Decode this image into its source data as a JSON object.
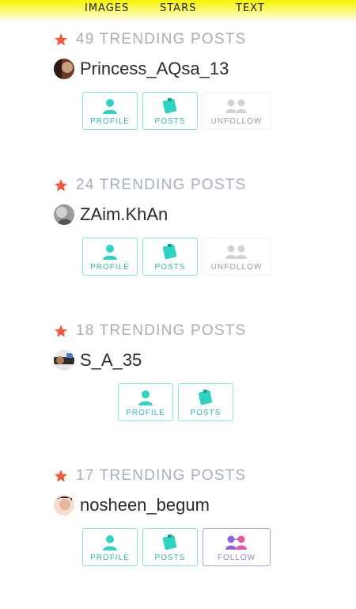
{
  "tabs": {
    "images": "IMAGES",
    "stars": "STARS",
    "text": "TEXT"
  },
  "colors": {
    "teal": "#2fd3c2",
    "purple": "#8c61e0",
    "pink": "#e9569b",
    "star": "#f05a3a"
  },
  "posts": [
    {
      "trending": "49 TRENDING POSTS",
      "username": "Princess_AQsa_13",
      "profile": "PROFILE",
      "posts": "POSTS",
      "follow": "UNFOLLOW"
    },
    {
      "trending": "24 TRENDING POSTS",
      "username": "ZAim.KhAn",
      "profile": "PROFILE",
      "posts": "POSTS",
      "follow": "UNFOLLOW"
    },
    {
      "trending": "18 TRENDING POSTS",
      "username": "S_A_35",
      "profile": "PROFILE",
      "posts": "POSTS"
    },
    {
      "trending": "17 TRENDING POSTS",
      "username": "nosheen_begum",
      "profile": "PROFILE",
      "posts": "POSTS",
      "follow": "FOLLOW"
    }
  ]
}
